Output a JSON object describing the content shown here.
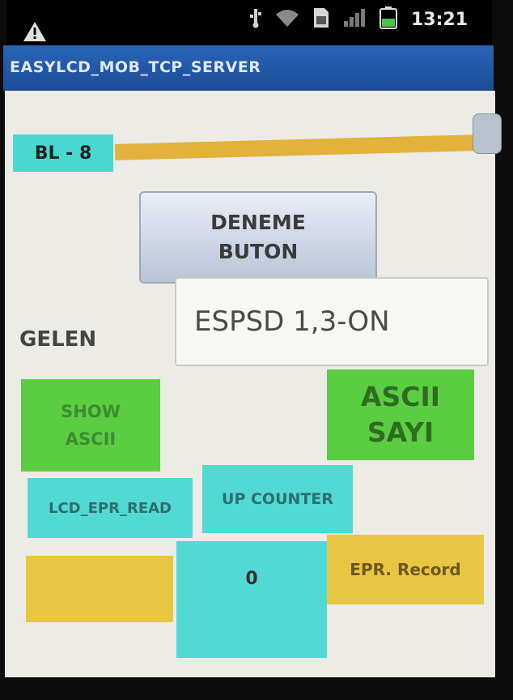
{
  "status_bar": {
    "clock": "13:21",
    "icons": [
      "warning-icon",
      "usb-icon",
      "wifi-icon",
      "sd-card-icon",
      "signal-icon",
      "battery-icon"
    ]
  },
  "app": {
    "title": "EASYLCD_MOB_TCP_SERVER"
  },
  "slider": {
    "label": "BL - 8",
    "value_fraction": 1.0
  },
  "deneme_button": {
    "line1": "DENEME",
    "line2": "BUTON"
  },
  "gelen": {
    "label": "GELEN",
    "value": "ESPSD 1,3-ON"
  },
  "buttons": {
    "show_ascii_line1": "SHOW",
    "show_ascii_line2": "ASCII",
    "ascii_sayi_line1": "ASCII",
    "ascii_sayi_line2": "SAYI",
    "lcd_epr_read": "LCD_EPR_READ",
    "up_counter": "UP COUNTER",
    "epr_record": "EPR. Record"
  },
  "counter": {
    "value": "0"
  },
  "colors": {
    "cyan": "#52d9d3",
    "green": "#5bcd43",
    "yellow": "#e8c642",
    "title_bar": "#2a64b8"
  }
}
